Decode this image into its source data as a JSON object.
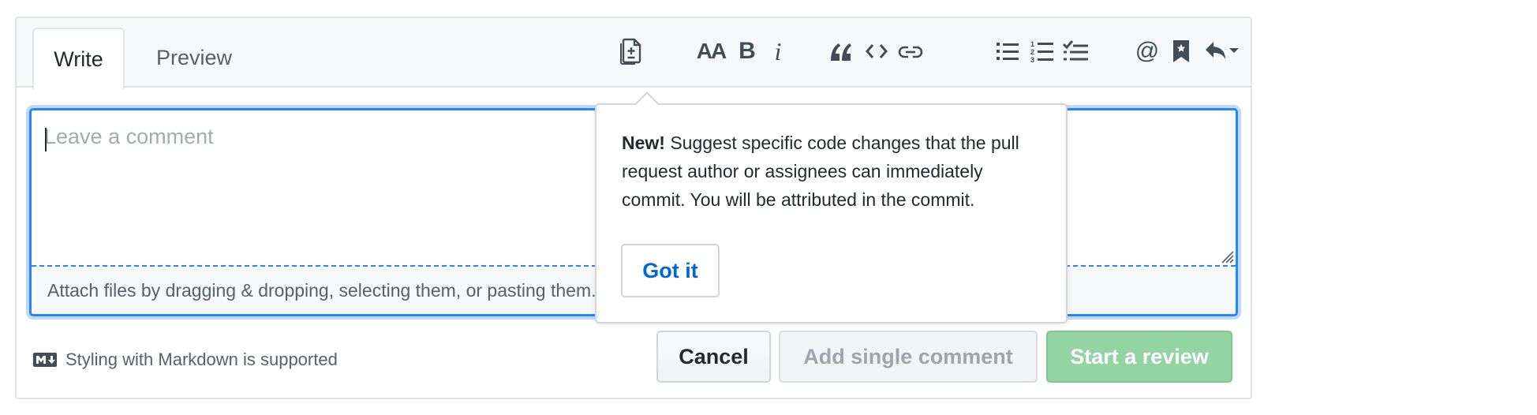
{
  "tabs": {
    "write": "Write",
    "preview": "Preview"
  },
  "toolbar": {
    "icons": [
      "suggestion-icon",
      "header-icon",
      "bold-icon",
      "italic-icon",
      "quote-icon",
      "code-icon",
      "link-icon",
      "bulleted-list-icon",
      "numbered-list-icon",
      "task-list-icon",
      "mention-icon",
      "reference-icon",
      "reply-icon"
    ],
    "bold_glyph": "B",
    "italic_glyph": "i",
    "header_glyph": "AA",
    "mention_glyph": "@"
  },
  "editor": {
    "placeholder": "Leave a comment",
    "value": "",
    "attach_text": "Attach files by dragging & dropping, selecting them, or pasting them."
  },
  "footer": {
    "markdown_note": "Styling with Markdown is supported",
    "cancel_label": "Cancel",
    "add_single_label": "Add single comment",
    "start_review_label": "Start a review"
  },
  "popover": {
    "new_label": "New!",
    "message": " Suggest specific code changes that the pull request author or assignees can immediately commit. You will be attributed in the commit.",
    "got_it_label": "Got it"
  },
  "colors": {
    "accent_blue": "#0366d6",
    "focus_blue": "#2188ff",
    "review_green": "#94d3a2",
    "header_bg": "#f6f8fa"
  }
}
